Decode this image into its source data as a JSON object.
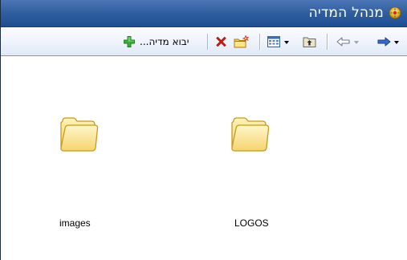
{
  "window": {
    "title": "מנהל המדיה",
    "title_icon": "media-manager-icon"
  },
  "toolbar": {
    "import_label": "יבוא מדיה...",
    "import_icon": "add-plus-icon",
    "delete_icon": "delete-x-icon",
    "new_folder_icon": "new-folder-icon",
    "view_icon": "view-grid-icon",
    "up_folder_icon": "up-folder-icon",
    "back_icon": "back-arrow-icon",
    "forward_icon": "forward-arrow-icon"
  },
  "content": {
    "items": [
      {
        "name": "images",
        "icon": "folder-icon"
      },
      {
        "name": "LOGOS",
        "icon": "folder-icon"
      }
    ]
  },
  "colors": {
    "titlebar": "#2f5ea0",
    "toolbar_bg": "#eef3fb",
    "folder_fill": "#ffe79a",
    "folder_stroke": "#c89a1e",
    "plus_green": "#2fa52f",
    "delete_red": "#d21a12"
  }
}
